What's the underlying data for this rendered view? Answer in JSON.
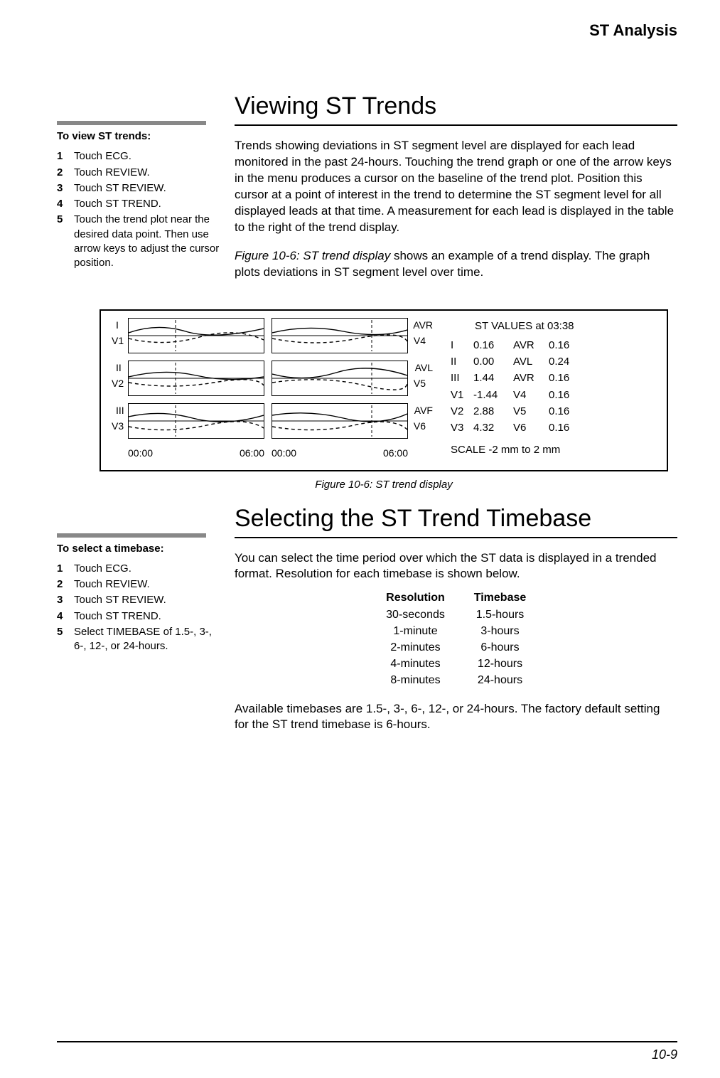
{
  "running_head": "ST Analysis",
  "page_number": "10-9",
  "section1": {
    "title": "Viewing ST Trends",
    "side_heading": "To view ST trends:",
    "steps": [
      "Touch ECG.",
      "Touch REVIEW.",
      "Touch ST REVIEW.",
      "Touch ST TREND.",
      "Touch the trend plot near the desired data point. Then use arrow keys to adjust the cursor position."
    ],
    "body1": "Trends showing deviations in ST segment level are displayed for each lead monitored in the past 24-hours. Touching the trend graph or one of the arrow keys in the menu produces a cursor on the baseline of the trend plot. Position this cursor at a point of interest in the trend to determine the ST segment level for all displayed leads at that time. A measurement for each lead is displayed in the table to the right of the trend display.",
    "body2_pre": "Figure 10-6: ST trend display",
    "body2_post": " shows an example of a trend display. The graph plots deviations in ST segment level over time."
  },
  "figure": {
    "caption": "Figure 10-6: ST trend display",
    "left_labels": [
      [
        "I",
        "V1"
      ],
      [
        "II",
        "V2"
      ],
      [
        "III",
        "V3"
      ]
    ],
    "right_labels": [
      [
        "AVR",
        "V4"
      ],
      [
        "AVL",
        "V5"
      ],
      [
        "AVF",
        "V6"
      ]
    ],
    "xaxis": {
      "start": "00:00",
      "end": "06:00"
    },
    "table_title": "ST VALUES at 03:38",
    "rows": [
      {
        "l": "I",
        "v": "0.16",
        "l2": "AVR",
        "v2": "0.16"
      },
      {
        "l": "II",
        "v": "0.00",
        "l2": "AVL",
        "v2": "0.24"
      },
      {
        "l": "III",
        "v": "1.44",
        "l2": "AVR",
        "v2": "0.16"
      },
      {
        "l": "V1",
        "v": "-1.44",
        "l2": "V4",
        "v2": "0.16"
      },
      {
        "l": "V2",
        "v": "2.88",
        "l2": "V5",
        "v2": "0.16"
      },
      {
        "l": "V3",
        "v": "4.32",
        "l2": "V6",
        "v2": "0.16"
      }
    ],
    "scale": "SCALE  -2 mm to 2 mm"
  },
  "section2": {
    "title": "Selecting the ST Trend Timebase",
    "side_heading": "To select a timebase:",
    "steps": [
      "Touch ECG.",
      "Touch REVIEW.",
      "Touch ST REVIEW.",
      "Touch ST TREND.",
      "Select TIMEBASE of 1.5-, 3-, 6-, 12-, or 24-hours."
    ],
    "body1": "You can select the time period over which the ST data is displayed in a trended format. Resolution for each timebase is shown below.",
    "table_head": {
      "c1": "Resolution",
      "c2": "Timebase"
    },
    "table_rows": [
      {
        "c1": "30-seconds",
        "c2": "1.5-hours"
      },
      {
        "c1": "1-minute",
        "c2": "3-hours"
      },
      {
        "c1": "2-minutes",
        "c2": "6-hours"
      },
      {
        "c1": "4-minutes",
        "c2": "12-hours"
      },
      {
        "c1": "8-minutes",
        "c2": "24-hours"
      }
    ],
    "body2": "Available timebases are 1.5-, 3-, 6-, 12-, or 24-hours. The factory default setting for the ST trend timebase is 6-hours."
  }
}
